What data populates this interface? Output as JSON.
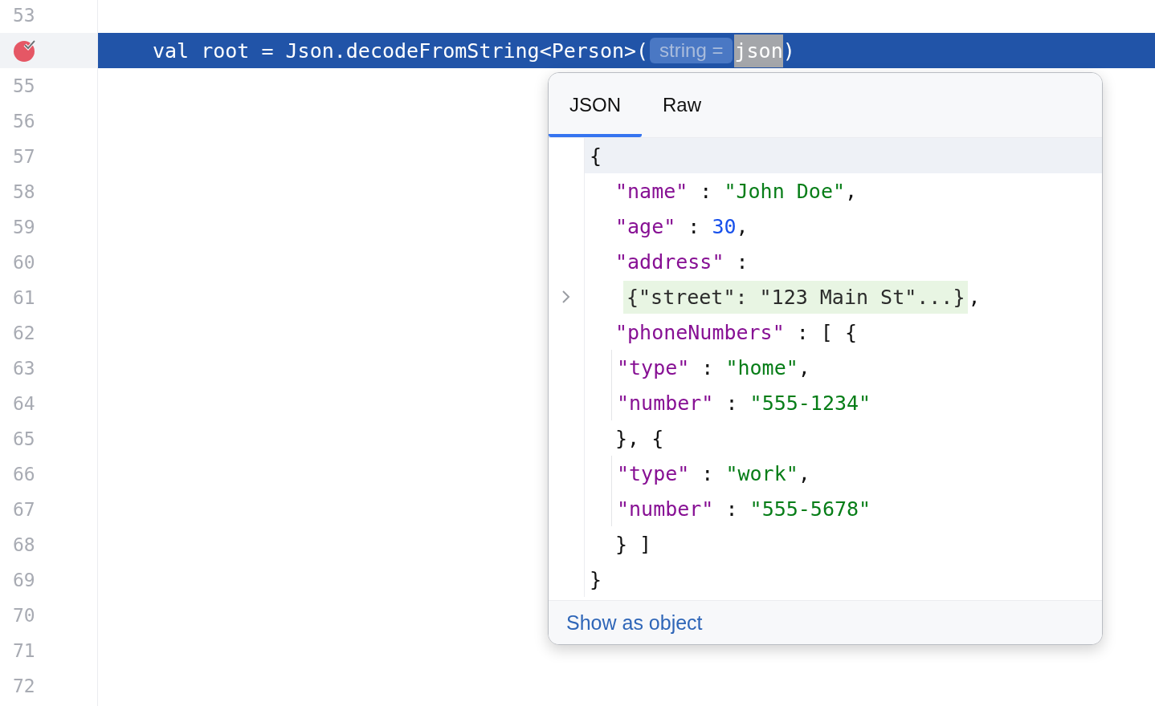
{
  "editor": {
    "lines": [
      {
        "number": "53",
        "breakpoint": false,
        "current": false
      },
      {
        "breakpoint": true,
        "current": true,
        "tokens": [
          {
            "kind": "code",
            "text": "val root = Json.decodeFromString<Person>("
          },
          {
            "kind": "hint",
            "text": "string ="
          },
          {
            "kind": "selected",
            "text": "json"
          },
          {
            "kind": "code",
            "text": ")"
          }
        ]
      },
      {
        "number": "55",
        "breakpoint": false,
        "current": false
      },
      {
        "number": "56",
        "breakpoint": false,
        "current": false
      },
      {
        "number": "57",
        "breakpoint": false,
        "current": false
      },
      {
        "number": "58",
        "breakpoint": false,
        "current": false
      },
      {
        "number": "59",
        "breakpoint": false,
        "current": false
      },
      {
        "number": "60",
        "breakpoint": false,
        "current": false
      },
      {
        "number": "61",
        "breakpoint": false,
        "current": false
      },
      {
        "number": "62",
        "breakpoint": false,
        "current": false
      },
      {
        "number": "63",
        "breakpoint": false,
        "current": false
      },
      {
        "number": "64",
        "breakpoint": false,
        "current": false
      },
      {
        "number": "65",
        "breakpoint": false,
        "current": false
      },
      {
        "number": "66",
        "breakpoint": false,
        "current": false
      },
      {
        "number": "67",
        "breakpoint": false,
        "current": false
      },
      {
        "number": "68",
        "breakpoint": false,
        "current": false
      },
      {
        "number": "69",
        "breakpoint": false,
        "current": false
      },
      {
        "number": "70",
        "breakpoint": false,
        "current": false
      },
      {
        "number": "71",
        "breakpoint": false,
        "current": false
      },
      {
        "number": "72",
        "breakpoint": false,
        "current": false
      }
    ]
  },
  "popup": {
    "tabs": [
      {
        "label": "JSON",
        "selected": true
      },
      {
        "label": "Raw",
        "selected": false
      }
    ],
    "lines": [
      {
        "current": true,
        "tokens": [
          {
            "kind": "punct",
            "text": "{"
          }
        ],
        "children": [
          {
            "tokens": [
              {
                "kind": "key",
                "text": "\"name\""
              },
              {
                "kind": "punct",
                "text": " : "
              },
              {
                "kind": "string",
                "text": "\"John Doe\""
              },
              {
                "kind": "punct",
                "text": ","
              }
            ]
          },
          {
            "tokens": [
              {
                "kind": "key",
                "text": "\"age\""
              },
              {
                "kind": "punct",
                "text": " : "
              },
              {
                "kind": "number",
                "text": "30"
              },
              {
                "kind": "punct",
                "text": ","
              }
            ]
          },
          {
            "tokens": [
              {
                "kind": "key",
                "text": "\"address\""
              },
              {
                "kind": "punct",
                "text": " :"
              }
            ]
          },
          {
            "tokens": [
              {
                "kind": "folded",
                "text": "{\"street\": \"123 Main St\"...}"
              },
              {
                "kind": "punct",
                "text": ","
              }
            ]
          },
          {
            "tokens": [
              {
                "kind": "key",
                "text": "\"phoneNumbers\""
              },
              {
                "kind": "punct",
                "text": " : [ {"
              }
            ],
            "children": [
              {
                "tokens": [
                  {
                    "kind": "key",
                    "text": "\"type\""
                  },
                  {
                    "kind": "punct",
                    "text": " : "
                  },
                  {
                    "kind": "string",
                    "text": "\"home\""
                  },
                  {
                    "kind": "punct",
                    "text": ","
                  }
                ]
              },
              {
                "tokens": [
                  {
                    "kind": "key",
                    "text": "\"number\""
                  },
                  {
                    "kind": "punct",
                    "text": " : "
                  },
                  {
                    "kind": "string",
                    "text": "\"555-1234\""
                  }
                ]
              }
            ]
          },
          {
            "tokens": [
              {
                "kind": "punct",
                "text": "}, {"
              }
            ],
            "children": [
              {
                "tokens": [
                  {
                    "kind": "key",
                    "text": "\"type\""
                  },
                  {
                    "kind": "punct",
                    "text": " : "
                  },
                  {
                    "kind": "string",
                    "text": "\"work\""
                  },
                  {
                    "kind": "punct",
                    "text": ","
                  }
                ]
              },
              {
                "tokens": [
                  {
                    "kind": "key",
                    "text": "\"number\""
                  },
                  {
                    "kind": "punct",
                    "text": " : "
                  },
                  {
                    "kind": "string",
                    "text": "\"555-5678\""
                  }
                ]
              }
            ]
          },
          {
            "tokens": [
              {
                "kind": "punct",
                "text": "} ]"
              }
            ]
          }
        ]
      },
      {
        "current": false,
        "tokens": [
          {
            "kind": "punct",
            "text": "}"
          }
        ]
      }
    ],
    "footer_link": "Show as object"
  }
}
